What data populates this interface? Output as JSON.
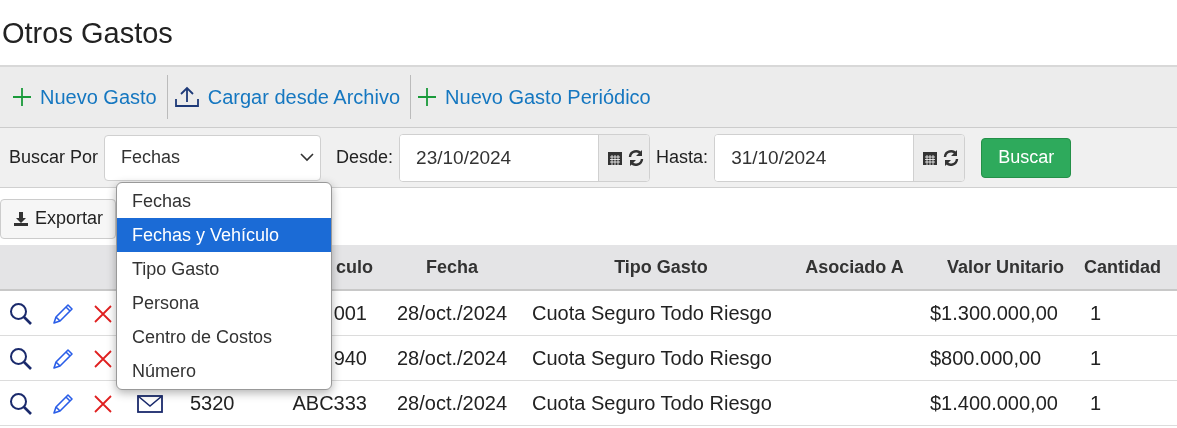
{
  "page_title": "Otros Gastos",
  "toolbar": [
    {
      "label": "Nuevo Gasto",
      "kind": "add"
    },
    {
      "label": "Cargar desde Archivo",
      "kind": "upload"
    },
    {
      "label": "Nuevo Gasto Periódico",
      "kind": "add"
    }
  ],
  "search": {
    "label": "Buscar Por",
    "select_value": "Fechas",
    "from_label": "Desde:",
    "from_value": "23/10/2024",
    "to_label": "Hasta:",
    "to_value": "31/10/2024",
    "button": "Buscar"
  },
  "dropdown": [
    {
      "label": "Fechas",
      "selected": false
    },
    {
      "label": "Fechas y Vehículo",
      "selected": true
    },
    {
      "label": "Tipo Gasto",
      "selected": false
    },
    {
      "label": "Persona",
      "selected": false
    },
    {
      "label": "Centro de Costos",
      "selected": false
    },
    {
      "label": "Número",
      "selected": false
    }
  ],
  "export_button": "Exportar",
  "table": {
    "columns": [
      "culo",
      "Fecha",
      "Tipo Gasto",
      "Asociado A",
      "Valor Unitario",
      "Cantidad"
    ],
    "rows": [
      {
        "plate": "001",
        "date": "28/oct./2024",
        "type": "Cuota Seguro Todo Riesgo",
        "unit_value": "$1.300.000,00",
        "quantity": "1"
      },
      {
        "plate": "940",
        "date": "28/oct./2024",
        "type": "Cuota Seguro Todo Riesgo",
        "unit_value": "$800.000,00",
        "quantity": "1"
      },
      {
        "mail_icon": true,
        "number": "5320",
        "plate": "ABC333",
        "date": "28/oct./2024",
        "type": "Cuota Seguro Todo Riesgo",
        "unit_value": "$1.400.000,00",
        "quantity": "1"
      }
    ]
  }
}
